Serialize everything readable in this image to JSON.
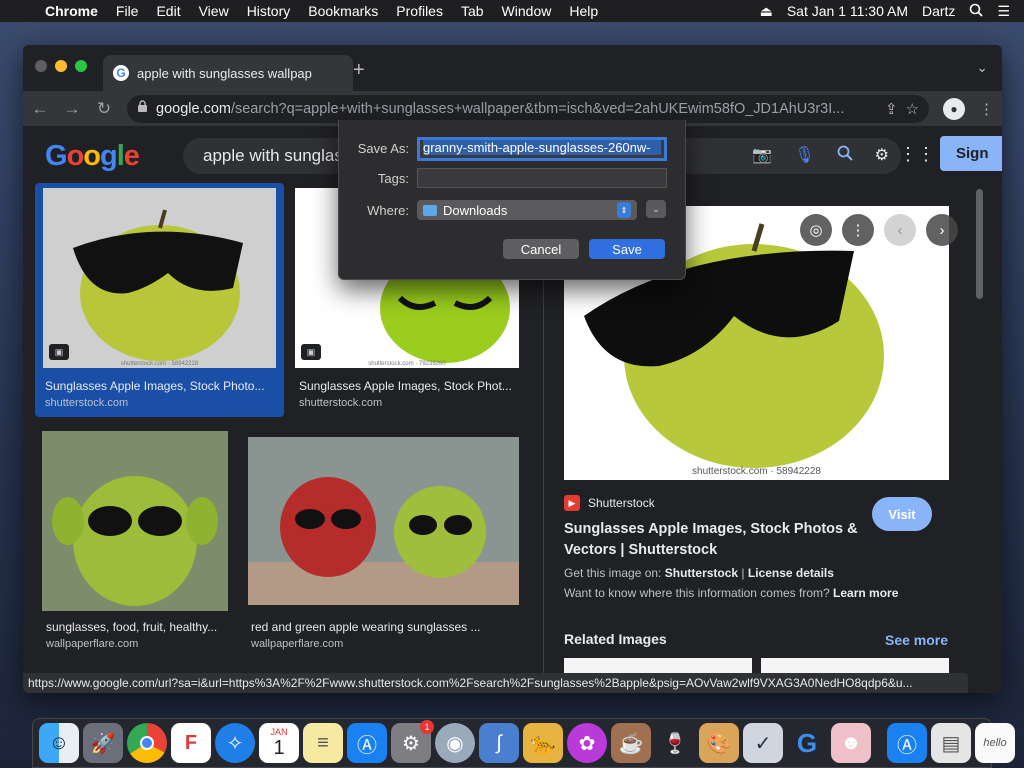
{
  "menubar": {
    "items": [
      "Chrome",
      "File",
      "Edit",
      "View",
      "History",
      "Bookmarks",
      "Profiles",
      "Tab",
      "Window",
      "Help"
    ],
    "datetime": "Sat Jan 1  11:30 AM",
    "user": "Dartz"
  },
  "browser": {
    "tab_title": "apple with sunglasses wallpap",
    "url_domain": "google.com",
    "url_path": "/search?q=apple+with+sunglasses+wallpaper&tbm=isch&ved=2ahUKEwim58fO_JD1AhU3r3I...",
    "status_url": "https://www.google.com/url?sa=i&url=https%3A%2F%2Fwww.shutterstock.com%2Fsearch%2Fsunglasses%2Bapple&psig=AOvVaw2wlf9VXAG3A0NedHO8qdp6&u..."
  },
  "google": {
    "logo": "Google",
    "query": "apple with sunglass",
    "signin_label": "Sign"
  },
  "results": [
    {
      "title": "Sunglasses Apple Images, Stock Photo...",
      "source": "shutterstock.com",
      "watermark": "shutterstock.com · 58942228"
    },
    {
      "title": "Sunglasses Apple Images, Stock Phot...",
      "source": "shutterstock.com",
      "watermark": "shutterstock.com · 79238260"
    },
    {
      "title": "sunglasses, food, fruit, healthy...",
      "source": "wallpaperflare.com"
    },
    {
      "title": "red and green apple wearing sunglasses ...",
      "source": "wallpaperflare.com"
    }
  ],
  "preview": {
    "watermark": "shutterstock.com · 58942228",
    "source_name": "Shutterstock",
    "visit_label": "Visit",
    "title": "Sunglasses Apple Images, Stock Photos & Vectors | Shutterstock",
    "get_image_prefix": "Get this image on:",
    "get_image_source": "Shutterstock",
    "license": "License details",
    "want_to_know": "Want to know where this information comes from?",
    "learn_more": "Learn more",
    "related": "Related Images",
    "see_more": "See more"
  },
  "save_dialog": {
    "save_as_label": "Save As:",
    "save_as_value": "granny-smith-apple-sunglasses-260nw-",
    "tags_label": "Tags:",
    "where_label": "Where:",
    "where_value": "Downloads",
    "cancel_label": "Cancel",
    "save_label": "Save"
  },
  "dock": {
    "calendar_month": "JAN",
    "calendar_day": "1",
    "badge": "1"
  }
}
